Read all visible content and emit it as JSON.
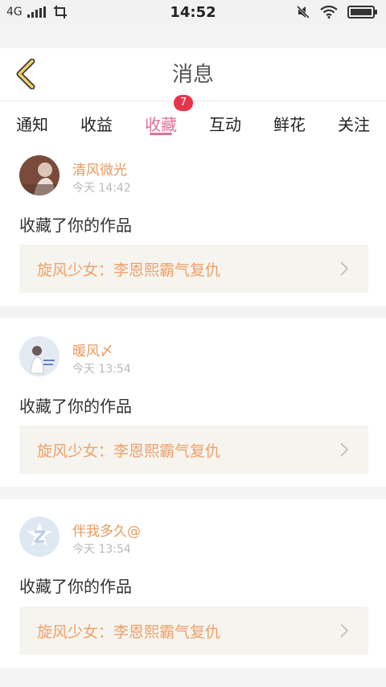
{
  "status_bar": {
    "network": "4G",
    "time": "14:52"
  },
  "header": {
    "title": "消息"
  },
  "tabs": [
    {
      "label": "通知"
    },
    {
      "label": "收益"
    },
    {
      "label": "收藏",
      "badge": "7",
      "active": true
    },
    {
      "label": "互动"
    },
    {
      "label": "鲜花"
    },
    {
      "label": "关注"
    }
  ],
  "messages": [
    {
      "user": "清风微光",
      "time": "今天 14:42",
      "action": "收藏了你的作品",
      "work": "旋风少女：李恩熙霸气复仇"
    },
    {
      "user": "暖风〆",
      "time": "今天 13:54",
      "action": "收藏了你的作品",
      "work": "旋风少女：李恩熙霸气复仇"
    },
    {
      "user": "伴我多久@",
      "time": "今天 13:54",
      "action": "收藏了你的作品",
      "work": "旋风少女：李恩熙霸气复仇"
    }
  ],
  "colors": {
    "accent": "#e4709a",
    "badge": "#e8344b",
    "username": "#e89a5e",
    "work_title": "#efa16c",
    "back_icon": "#f0d060"
  }
}
